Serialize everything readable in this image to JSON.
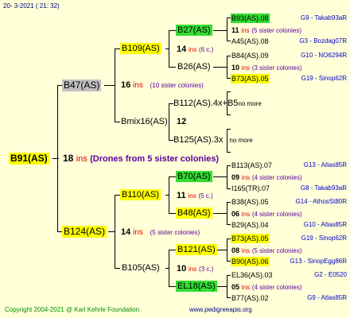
{
  "header": {
    "date": "20-   3-2021  (  21:  32)"
  },
  "footer": {
    "copyright": "Copyright 2004-2021 @ Karl Kehrle Foundation",
    "website": "www.pedigreeapis.org"
  },
  "labels": {
    "ins": "ins"
  },
  "root": {
    "name": "B91(AS)",
    "count": "18",
    "drones": "(Drones from 5 sister colonies)"
  },
  "gen2": [
    {
      "name": "B47(AS)",
      "count": "16",
      "sisters": "(10 sister colonies)"
    },
    {
      "name": "B124(AS)",
      "count": "14",
      "sisters": "(5 sister colonies)"
    }
  ],
  "gen3": [
    {
      "name": "B109(AS)",
      "count": "14",
      "sisters": "(6 c.)"
    },
    {
      "name": "Bmix16(AS)",
      "count": "12"
    },
    {
      "name": "B110(AS)",
      "count": "11",
      "sisters": "(5 c.)"
    },
    {
      "name": "B105(AS)",
      "count": "10",
      "sisters": "(3 c.)"
    }
  ],
  "gen4": [
    {
      "name": "B27(AS)"
    },
    {
      "name": "B26(AS)"
    },
    {
      "name": "B112(AS).4x+B5",
      "note": "no more"
    },
    {
      "name": "B125(AS).3x",
      "note": "no more"
    },
    {
      "name": "B70(AS)"
    },
    {
      "name": "B48(AS)"
    },
    {
      "name": "B121(AS)"
    },
    {
      "name": "EL18(AS)"
    }
  ],
  "gen5": [
    {
      "type": "queen",
      "name": "B93(AS).08",
      "ref": "G9 - Takab93aR",
      "color": "green"
    },
    {
      "type": "ins",
      "count": "11",
      "sisters": "(5 sister colonies)"
    },
    {
      "type": "queen",
      "name": "A45(AS).08",
      "ref": "G3 - Bozdag07R",
      "color": "none"
    },
    {
      "type": "queen",
      "name": "B84(AS).09",
      "ref": "G10 - NO6294R",
      "color": "none"
    },
    {
      "type": "ins",
      "count": "10",
      "sisters": "(3 sister colonies)"
    },
    {
      "type": "queen",
      "name": "B73(AS).05",
      "ref": "G19 - Sinop62R",
      "color": "yellow"
    },
    {
      "type": "queen",
      "name": "B113(AS).07",
      "ref": "G13 - Atlas85R",
      "color": "none"
    },
    {
      "type": "ins",
      "count": "09",
      "sisters": "(4 sister colonies)"
    },
    {
      "type": "queen",
      "name": "I165(TR).07",
      "ref": "G8 - Takab93aR",
      "color": "none"
    },
    {
      "type": "queen",
      "name": "B38(AS).05",
      "ref": "G14 - AthosSt80R",
      "color": "none"
    },
    {
      "type": "ins",
      "count": "06",
      "sisters": "(4 sister colonies)"
    },
    {
      "type": "queen",
      "name": "B29(AS).04",
      "ref": "G10 - Atlas85R",
      "color": "none"
    },
    {
      "type": "queen",
      "name": "B73(AS).05",
      "ref": "G19 - Sinop62R",
      "color": "yellow"
    },
    {
      "type": "ins",
      "count": "08",
      "sisters": "(5 sister colonies)"
    },
    {
      "type": "queen",
      "name": "B90(AS).06",
      "ref": "G13 - SinopEgg86R",
      "color": "yellow"
    },
    {
      "type": "queen",
      "name": "EL36(AS).03",
      "ref": "G2 - E0520",
      "color": "none"
    },
    {
      "type": "ins",
      "count": "05",
      "sisters": "(4 sister colonies)"
    },
    {
      "type": "queen",
      "name": "B77(AS).02",
      "ref": "G9 - Atlas85R",
      "color": "none"
    }
  ]
}
